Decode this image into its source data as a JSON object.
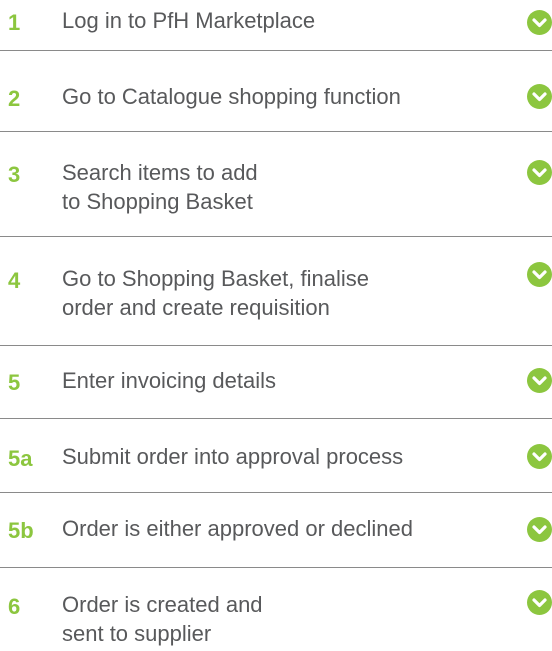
{
  "colors": {
    "number": "#8cc63f",
    "text": "#58595b",
    "check_fill": "#8cc63f",
    "check_mark": "#ffffff",
    "divider": "#8a8a8a"
  },
  "check_icon": "check-circle-icon",
  "steps": [
    {
      "num": "1",
      "lines": [
        "Log in to PfH Marketplace"
      ]
    },
    {
      "num": "2",
      "lines": [
        "Go to Catalogue shopping function"
      ]
    },
    {
      "num": "3",
      "lines": [
        "Search items to add",
        "to Shopping Basket"
      ]
    },
    {
      "num": "4",
      "lines": [
        "Go to Shopping Basket, finalise",
        "order and create requisition"
      ]
    },
    {
      "num": "5",
      "lines": [
        "Enter invoicing details"
      ]
    },
    {
      "num": "5a",
      "lines": [
        "Submit order into approval process"
      ]
    },
    {
      "num": "5b",
      "lines": [
        "Order is either approved or declined"
      ]
    },
    {
      "num": "6",
      "lines": [
        "Order is created and",
        "sent to supplier"
      ]
    }
  ]
}
